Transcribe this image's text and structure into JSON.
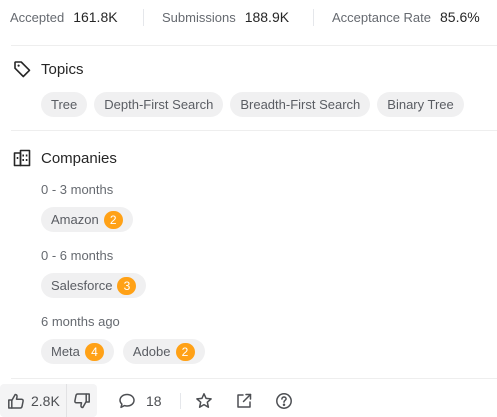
{
  "stats": [
    {
      "label": "Accepted",
      "value": "161.8K"
    },
    {
      "label": "Submissions",
      "value": "188.9K"
    },
    {
      "label": "Acceptance Rate",
      "value": "85.6%"
    }
  ],
  "topics": {
    "title": "Topics",
    "icon": "tag-icon",
    "tags": [
      "Tree",
      "Depth-First Search",
      "Breadth-First Search",
      "Binary Tree"
    ]
  },
  "companies": {
    "title": "Companies",
    "icon": "building-icon",
    "groups": [
      {
        "period": "0 - 3 months",
        "items": [
          {
            "name": "Amazon",
            "count": "2"
          }
        ]
      },
      {
        "period": "0 - 6 months",
        "items": [
          {
            "name": "Salesforce",
            "count": "3"
          }
        ]
      },
      {
        "period": "6 months ago",
        "items": [
          {
            "name": "Meta",
            "count": "4"
          },
          {
            "name": "Adobe",
            "count": "2"
          }
        ]
      }
    ]
  },
  "bottom_bar": {
    "likes": "2.8K",
    "comments": "18",
    "icons": [
      "thumbs-up-icon",
      "thumbs-down-icon",
      "comment-icon",
      "star-icon",
      "share-icon",
      "help-icon"
    ]
  },
  "colors": {
    "accent_orange": "#ffa116",
    "chip_bg": "#f0f0f1",
    "muted_text": "#666a70"
  }
}
